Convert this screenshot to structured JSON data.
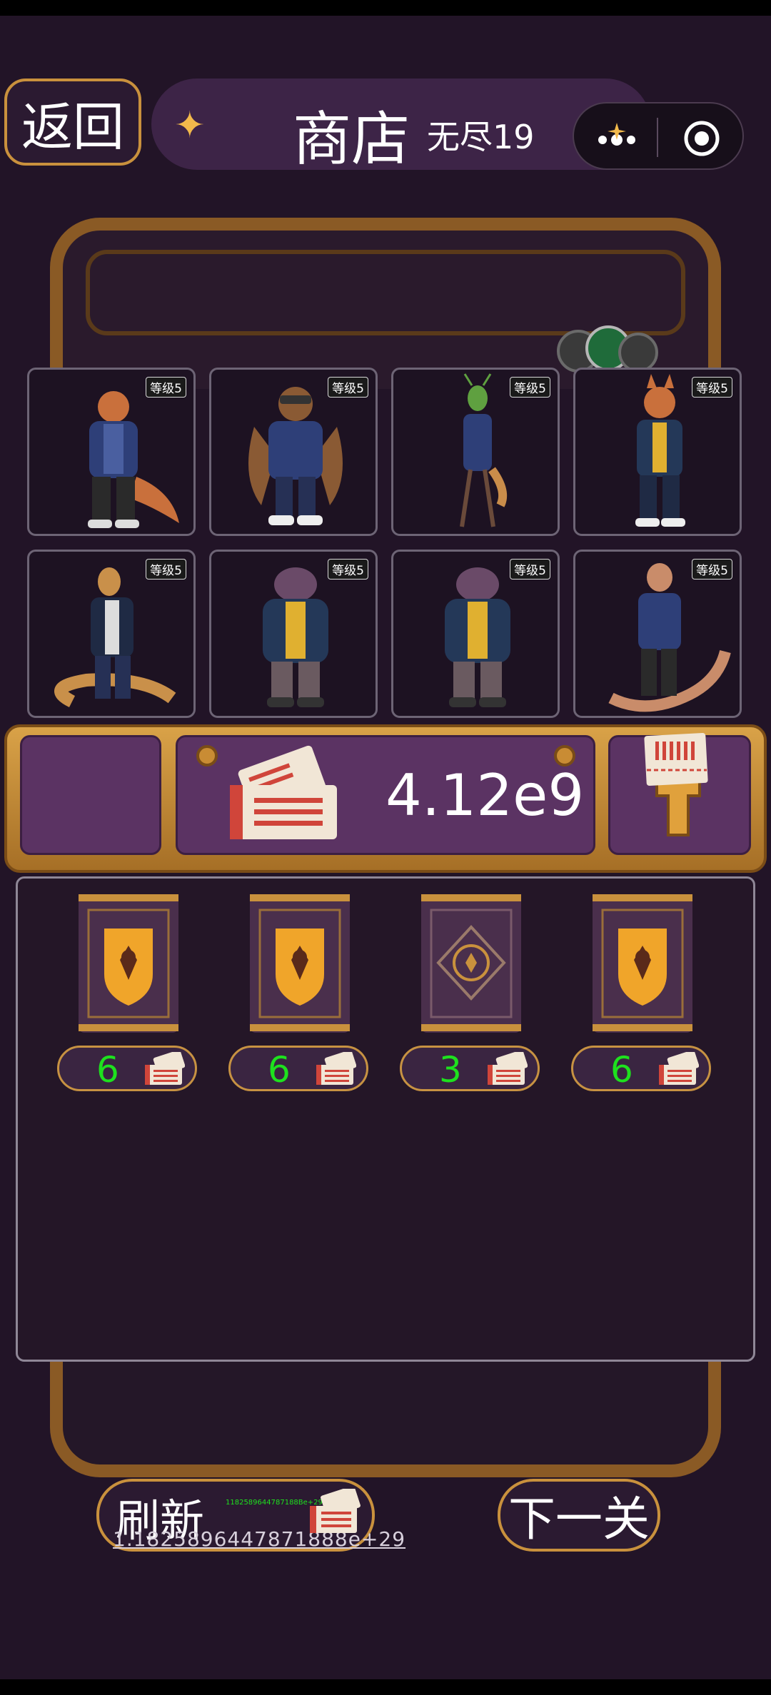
{
  "header": {
    "back_label": "返回",
    "title": "商店",
    "subtitle": "无尽19"
  },
  "characters": [
    {
      "level": "等级5",
      "icon": "dragon-character"
    },
    {
      "level": "等级5",
      "icon": "eagle-character"
    },
    {
      "level": "等级5",
      "icon": "mantis-character"
    },
    {
      "level": "等级5",
      "icon": "fox-character"
    },
    {
      "level": "等级5",
      "icon": "snake-character"
    },
    {
      "level": "等级5",
      "icon": "hippo-character"
    },
    {
      "level": "等级5",
      "icon": "hippo-character"
    },
    {
      "level": "等级5",
      "icon": "cobra-character"
    }
  ],
  "currency": {
    "value": "4.12e9",
    "icon": "ticket-icon"
  },
  "shop_items": [
    {
      "price": "6",
      "style": "gold"
    },
    {
      "price": "6",
      "style": "gold"
    },
    {
      "price": "3",
      "style": "purple"
    },
    {
      "price": "6",
      "style": "gold"
    }
  ],
  "footer": {
    "refresh_label": "刷新",
    "refresh_cost_small": "1182589644787188Be+29",
    "refresh_cost": "1.1825896447871888e+29",
    "next_label": "下一关"
  },
  "colors": {
    "background": "#221427",
    "accent_gold": "#c9913d",
    "price_green": "#1ee11e"
  }
}
